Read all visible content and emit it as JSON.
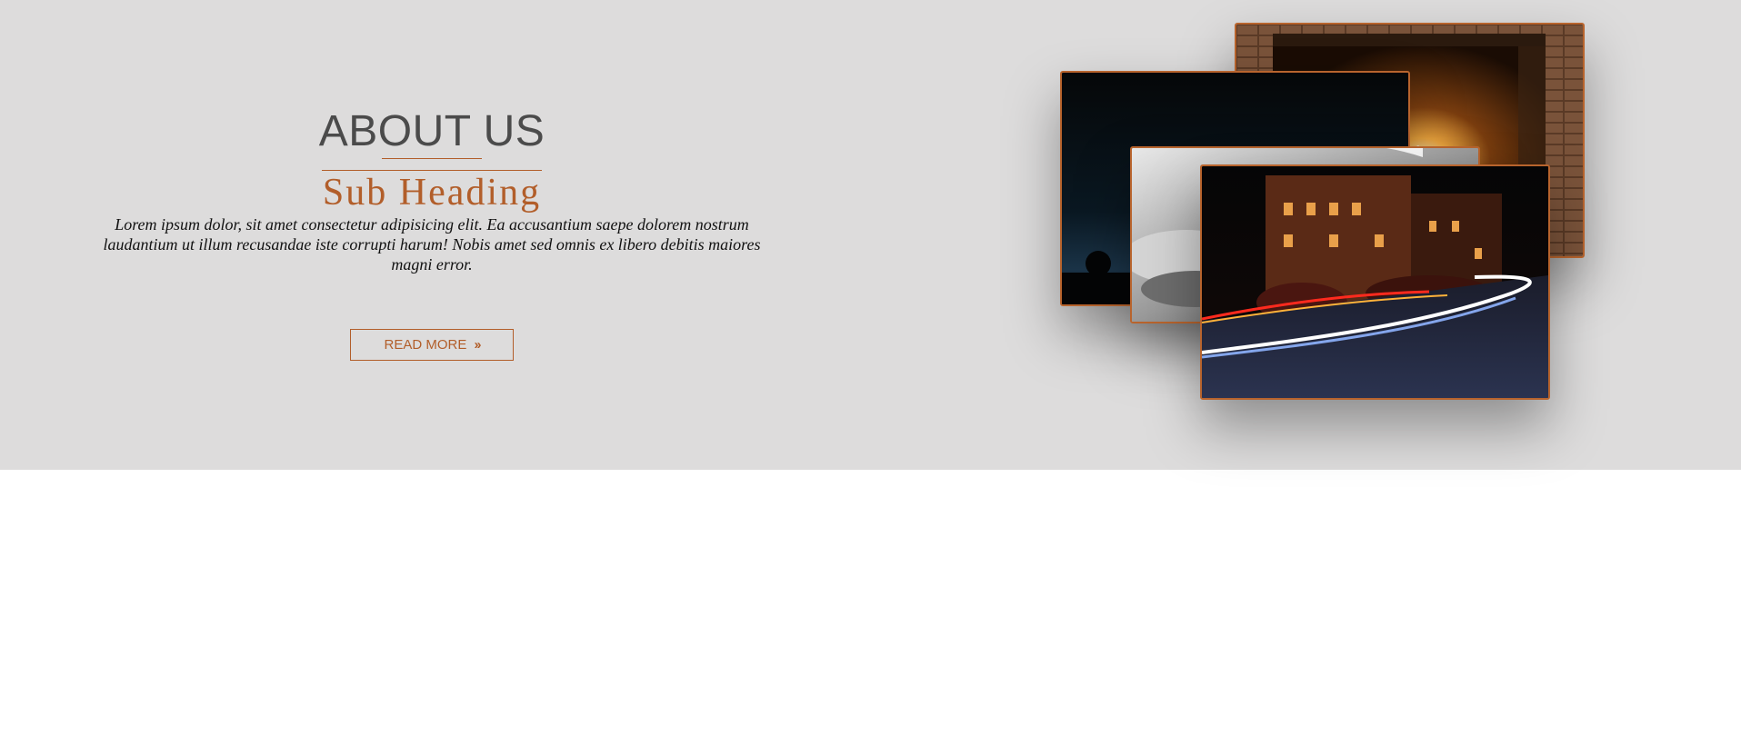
{
  "about": {
    "title": "ABOUT US",
    "subheading": "Sub Heading",
    "body": "Lorem ipsum dolor, sit amet consectetur adipisicing elit. Ea accusantium saepe dolorem nostrum laudantium ut illum recusandae iste corrupti harum! Nobis amet sed omnis ex libero debitis maiores magni error.",
    "button_label": "READ MORE",
    "button_icon": "double-chevron-right-icon"
  },
  "colors": {
    "accent": "#b25e2a",
    "section_background": "#dddcdc",
    "title_text": "#4b4b4b",
    "page_background": "#ffffff"
  },
  "photos": [
    {
      "name": "fireplace-photo"
    },
    {
      "name": "night-sky-photo"
    },
    {
      "name": "hands-photo"
    },
    {
      "name": "city-street-light-trails-photo"
    }
  ]
}
